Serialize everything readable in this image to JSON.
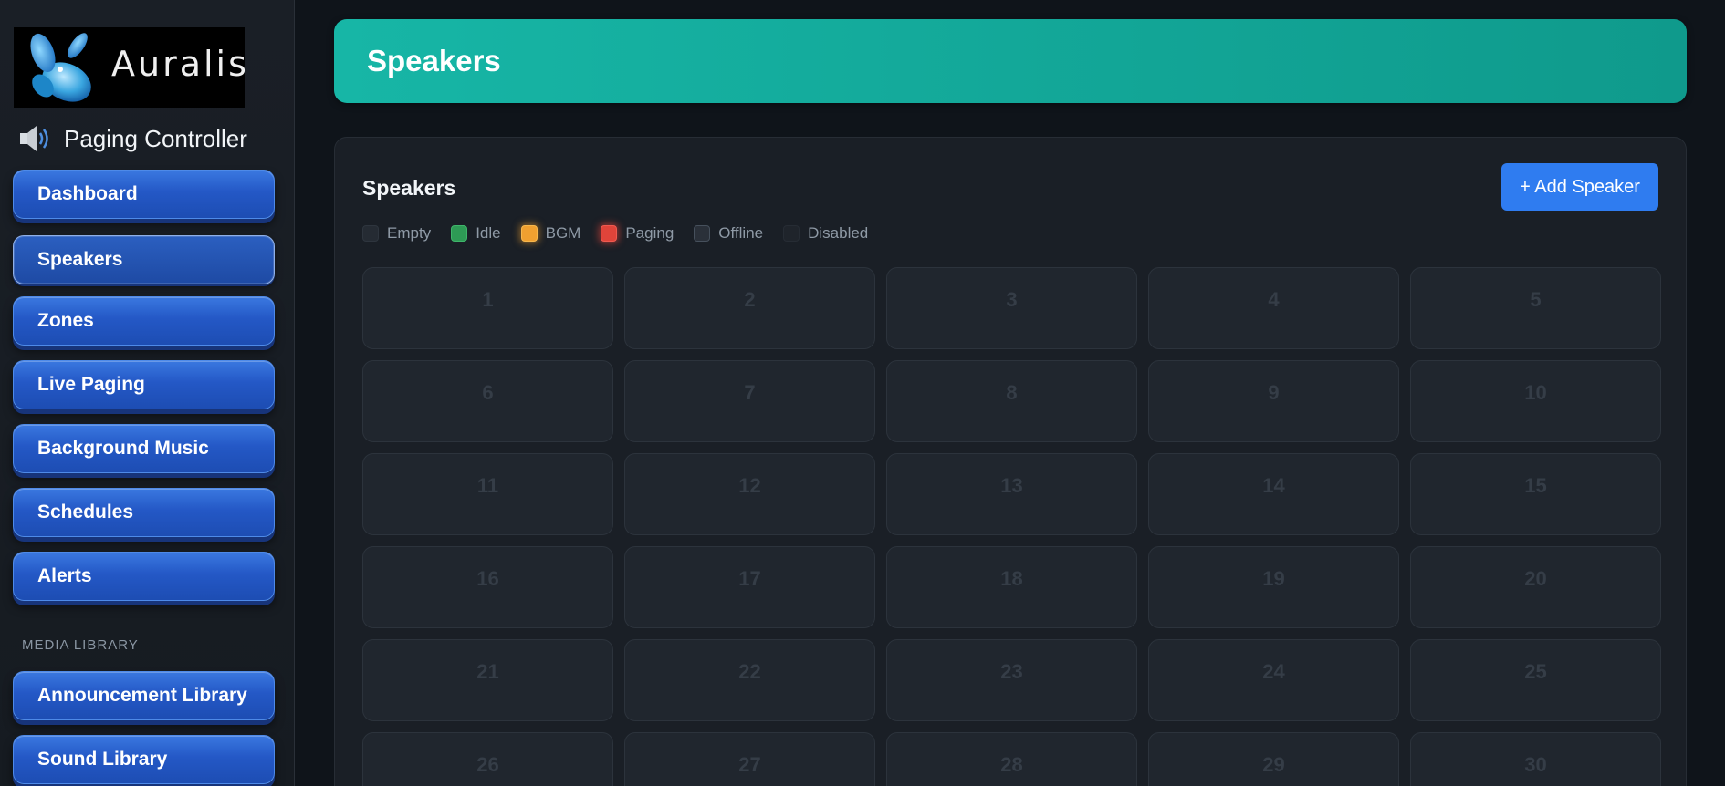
{
  "brand": {
    "name": "Auralis"
  },
  "controller": {
    "title": "Paging Controller"
  },
  "sidebar": {
    "items": [
      {
        "label": "Dashboard",
        "name": "sidebar-item-dashboard",
        "active": false
      },
      {
        "label": "Speakers",
        "name": "sidebar-item-speakers",
        "active": true
      },
      {
        "label": "Zones",
        "name": "sidebar-item-zones",
        "active": false
      },
      {
        "label": "Live Paging",
        "name": "sidebar-item-live-paging",
        "active": false
      },
      {
        "label": "Background Music",
        "name": "sidebar-item-background-music",
        "active": false
      },
      {
        "label": "Schedules",
        "name": "sidebar-item-schedules",
        "active": false
      },
      {
        "label": "Alerts",
        "name": "sidebar-item-alerts",
        "active": false
      }
    ],
    "section_label": "MEDIA LIBRARY",
    "media_items": [
      {
        "label": "Announcement Library",
        "name": "sidebar-item-announcement-library"
      },
      {
        "label": "Sound Library",
        "name": "sidebar-item-sound-library"
      }
    ]
  },
  "header": {
    "title": "Speakers"
  },
  "panel": {
    "title": "Speakers",
    "add_button_label": "+ Add Speaker",
    "legend": [
      {
        "label": "Empty",
        "color": "#252b33",
        "border": "#2e353e",
        "glow": ""
      },
      {
        "label": "Idle",
        "color": "#2e9a55",
        "border": "#3fb56a",
        "glow": ""
      },
      {
        "label": "BGM",
        "color": "#f0a030",
        "border": "#f7b74d",
        "glow": "rgba(240,160,48,0.5)"
      },
      {
        "label": "Paging",
        "color": "#e0443a",
        "border": "#f05a50",
        "glow": "rgba(224,68,58,0.6)"
      },
      {
        "label": "Offline",
        "color": "#2a3039",
        "border": "#46505c",
        "glow": ""
      },
      {
        "label": "Disabled",
        "color": "#1f242b",
        "border": "#262c34",
        "glow": ""
      }
    ],
    "slots": [
      "1",
      "2",
      "3",
      "4",
      "5",
      "6",
      "7",
      "8",
      "9",
      "10",
      "11",
      "12",
      "13",
      "14",
      "15",
      "16",
      "17",
      "18",
      "19",
      "20",
      "21",
      "22",
      "23",
      "24",
      "25",
      "26",
      "27",
      "28",
      "29",
      "30"
    ]
  },
  "icons": {
    "speaker": "speaker-icon",
    "logo": "auralis-logo-icon"
  }
}
